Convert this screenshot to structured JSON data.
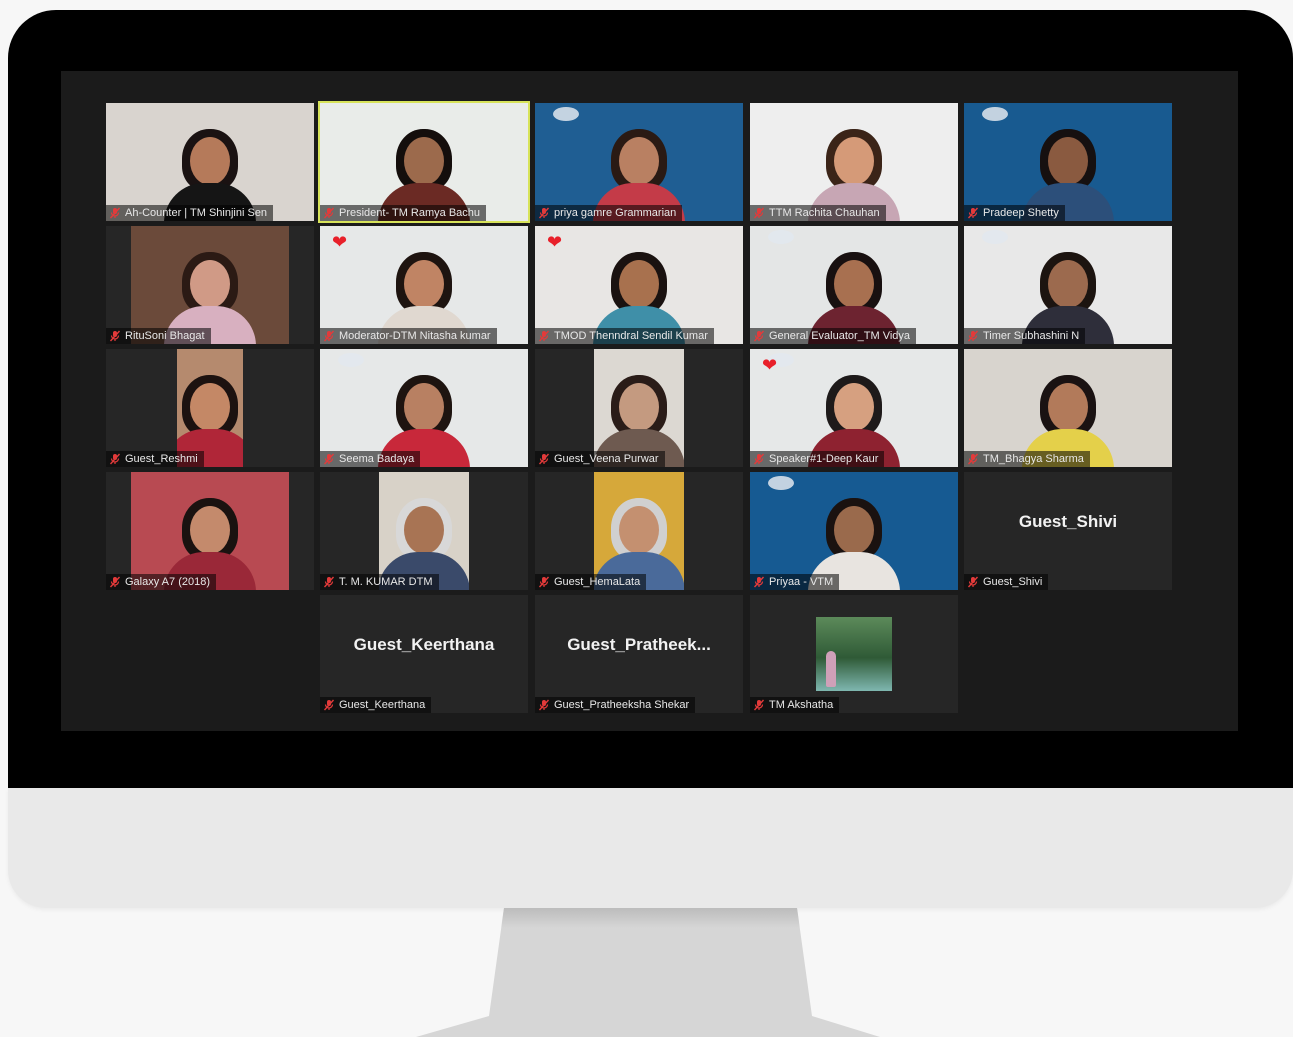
{
  "participants": [
    {
      "label": "Ah-Counter | TM Shinjini Sen",
      "bg": "#d9d4cf",
      "skin": "#b57a5a",
      "hair": "#1a1212",
      "shirt": "#151515",
      "vw": 208,
      "vx": 0
    },
    {
      "label": "President- TM Ramya Bachu",
      "bg": "#e9ece9",
      "skin": "#9c6a4c",
      "hair": "#140e0c",
      "shirt": "#6b2a24",
      "vw": 208,
      "vx": 0,
      "active": true
    },
    {
      "label": "priya gamre Grammarian",
      "bg": "#1f5e93",
      "skin": "#b98062",
      "hair": "#2a1a14",
      "shirt": "#c43b48",
      "vw": 208,
      "vx": 0,
      "logo": true
    },
    {
      "label": "TTM Rachita Chauhan",
      "bg": "#eeeeee",
      "skin": "#d59a78",
      "hair": "#3b2418",
      "shirt": "#c7a6b4",
      "vw": 208,
      "vx": 0
    },
    {
      "label": "Pradeep Shetty",
      "bg": "#185a90",
      "skin": "#8a5a40",
      "hair": "#161010",
      "shirt": "#2c4f7a",
      "vw": 208,
      "vx": 0,
      "logo": true
    },
    {
      "label": "RituSoni Bhagat",
      "bg": "#6b4a3a",
      "skin": "#d09a86",
      "hair": "#2b1a14",
      "shirt": "#d8b0c0",
      "vw": 158,
      "vx": 25
    },
    {
      "label": "Moderator-DTM Nitasha kumar",
      "bg": "#e6e8e8",
      "skin": "#c08464",
      "hair": "#1e1410",
      "shirt": "#e0d8d0",
      "vw": 208,
      "vx": 0,
      "heart": true
    },
    {
      "label": "TMOD Thenndral Sendil Kumar",
      "bg": "#e8e6e4",
      "skin": "#a8714e",
      "hair": "#1a1210",
      "shirt": "#3f8fa8",
      "vw": 208,
      "vx": 0,
      "heart": true
    },
    {
      "label": "General Evaluator_TM Vidya",
      "bg": "#e4e6e6",
      "skin": "#a87050",
      "hair": "#181010",
      "shirt": "#6d2330",
      "vw": 208,
      "vx": 0,
      "logo": true
    },
    {
      "label": "Timer Subhashini N",
      "bg": "#e8e8e8",
      "skin": "#9c6a4e",
      "hair": "#1c1410",
      "shirt": "#2e2e3a",
      "vw": 208,
      "vx": 0,
      "logo": true
    },
    {
      "label": "Guest_Reshmi",
      "bg": "#b58a6e",
      "skin": "#c48866",
      "hair": "#1c1210",
      "shirt": "#b02638",
      "vw": 66,
      "vx": 71
    },
    {
      "label": "Seema Badaya",
      "bg": "#e6e8e8",
      "skin": "#b88062",
      "hair": "#1e1410",
      "shirt": "#c8283a",
      "vw": 208,
      "vx": 0,
      "logo": true
    },
    {
      "label": "Guest_Veena Purwar",
      "bg": "#dcd8d2",
      "skin": "#c49a80",
      "hair": "#2a1c18",
      "shirt": "#6e5a50",
      "vw": 90,
      "vx": 59
    },
    {
      "label": "Speaker#1-Deep Kaur",
      "bg": "#e6e8e8",
      "skin": "#d6a080",
      "hair": "#1e1a1a",
      "shirt": "#8e2230",
      "vw": 208,
      "vx": 0,
      "heart": true,
      "logo": true
    },
    {
      "label": "TM_Bhagya Sharma",
      "bg": "#d8d4ce",
      "skin": "#b27a5a",
      "hair": "#1a1212",
      "shirt": "#e4d04a",
      "vw": 208,
      "vx": 0
    },
    {
      "label": "Galaxy A7 (2018)",
      "bg": "#b84a52",
      "skin": "#c48a6c",
      "hair": "#1a1210",
      "shirt": "#9a2838",
      "vw": 158,
      "vx": 25
    },
    {
      "label": "T. M. KUMAR DTM",
      "bg": "#d8d2c8",
      "skin": "#a87454",
      "hair": "#d8d8d8",
      "shirt": "#3a4a6a",
      "vw": 90,
      "vx": 59
    },
    {
      "label": "Guest_HemaLata",
      "bg": "#d6a83a",
      "skin": "#c49070",
      "hair": "#d0d0d0",
      "shirt": "#4a6a9a",
      "vw": 90,
      "vx": 59
    },
    {
      "label": "Priyaa - VTM",
      "bg": "#165a92",
      "skin": "#9a6a4c",
      "hair": "#1a1210",
      "shirt": "#e8e4e0",
      "vw": 208,
      "vx": 0,
      "logo": true
    },
    {
      "label": "Guest_Shivi",
      "name_only": "Guest_Shivi"
    },
    {
      "label": "Guest_Keerthana",
      "name_only": "Guest_Keerthana"
    },
    {
      "label": "Guest_Pratheeksha Shekar",
      "name_only": "Guest_Pratheek..."
    },
    {
      "label": "TM Akshatha",
      "avatar": true
    }
  ],
  "icons": {
    "mic": "mic-muted-icon",
    "heart": "heart-icon"
  },
  "colors": {
    "active_border": "#d7e35a",
    "muted": "#e33a3a",
    "screen": "#1b1b1b",
    "tile": "#262626"
  }
}
